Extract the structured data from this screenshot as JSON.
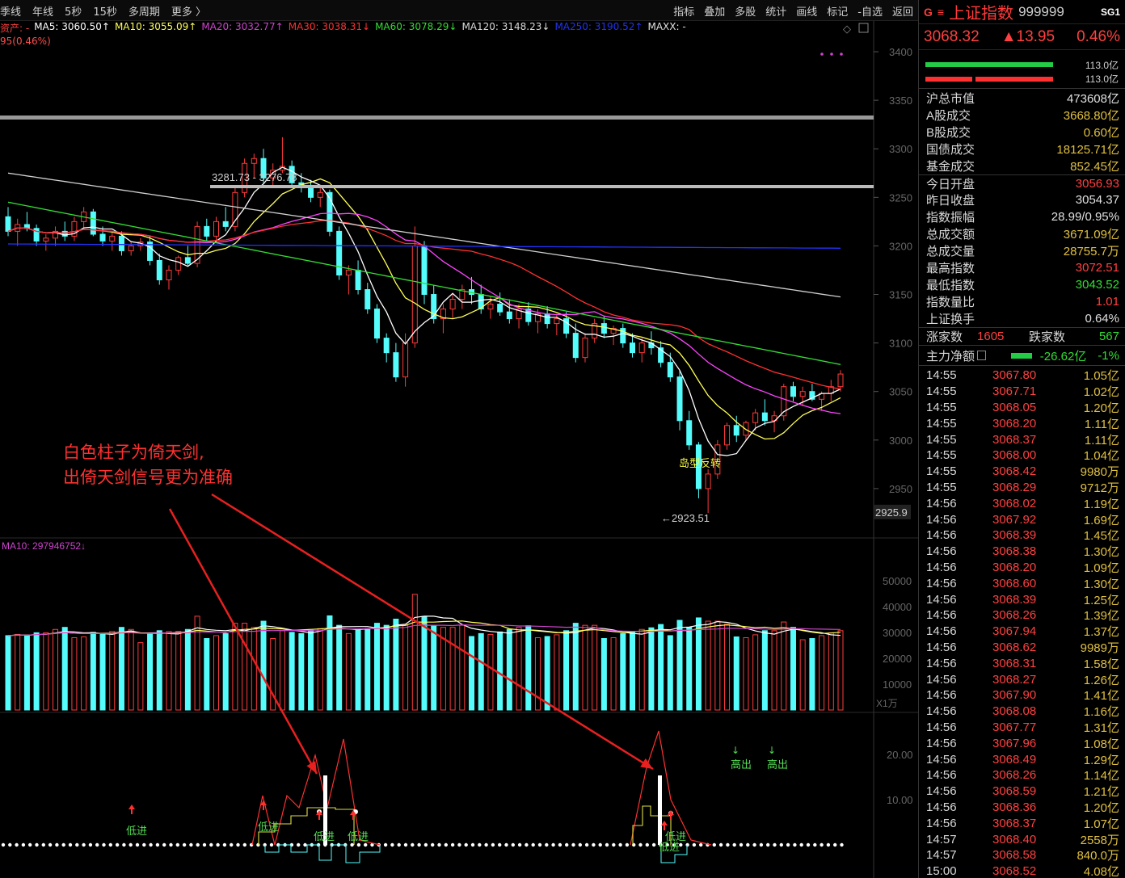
{
  "toolbar": {
    "left": [
      "季线",
      "年线",
      "5秒",
      "15秒",
      "多周期",
      "更多 〉"
    ],
    "right": [
      "指标",
      "叠加",
      "多股",
      "统计",
      "画线",
      "标记",
      "-自选",
      "返回"
    ]
  },
  "ma_line": {
    "prefix": "资产: -",
    "ma5": "MA5: 3060.50↑",
    "ma10": "MA10: 3055.09↑",
    "ma20": "MA20: 3032.77↑",
    "ma30": "MA30: 3038.31↓",
    "ma60": "MA60: 3078.29↓",
    "ma120": "MA120: 3148.23↓",
    "ma250": "MA250: 3190.52↑",
    "maxx": "MAXX: -",
    "change": "95(0.46%)"
  },
  "colors": {
    "up": "#ff3b3b",
    "down": "#54fcfc",
    "ma5": "#ffffff",
    "ma10": "#ffff55",
    "ma20": "#ff44ff",
    "ma30": "#ff3030",
    "ma60": "#33dd33",
    "ma120": "#cfcfcf",
    "ma250": "#2233ff"
  },
  "price_axis": [
    "3400",
    "3350",
    "3300",
    "3250",
    "3200",
    "3150",
    "3100",
    "3050",
    "3000",
    "2950"
  ],
  "price_current_tag": "2925.9",
  "high_label": "3281.73 - 3276.78",
  "low_label": "←2923.51",
  "pattern_label": "岛型反转",
  "annotation": {
    "line1": "白色柱子为倚天剑,",
    "line2": "出倚天剑信号更为准确"
  },
  "volume": {
    "ma_label": "MA10: 297946752↓",
    "axis": [
      "50000",
      "40000",
      "30000",
      "20000",
      "10000"
    ],
    "unit": "X1万"
  },
  "indicator": {
    "axis": [
      "20.00",
      "10.00"
    ],
    "labels": {
      "low_in_1": "低进",
      "low_in_2": "低进",
      "low_in_3": "低进",
      "low_in_4": "低进",
      "low_in_5": "低进",
      "low_in_6": "低进",
      "high_out_1": "高出",
      "high_out_2": "高出"
    }
  },
  "panel": {
    "g": "G",
    "menu": "≡",
    "name": "上证指数",
    "code": "999999",
    "sg": "SG1",
    "price": "3068.32",
    "change": "▲13.95",
    "pct": "0.46%",
    "bar_top": "113.0亿",
    "bar_bottom": "113.0亿",
    "stats": [
      {
        "label": "沪总市值",
        "value": "473608亿",
        "color": "#e0e0e0"
      },
      {
        "label": "A股成交",
        "value": "3668.80亿",
        "color": "#e0c040"
      },
      {
        "label": "B股成交",
        "value": "0.60亿",
        "color": "#e0c040"
      },
      {
        "label": "国债成交",
        "value": "18125.71亿",
        "color": "#e0c040"
      },
      {
        "label": "基金成交",
        "value": "852.45亿",
        "color": "#e0c040"
      },
      {
        "label": "今日开盘",
        "value": "3056.93",
        "color": "#ff4040"
      },
      {
        "label": "昨日收盘",
        "value": "3054.37",
        "color": "#e0e0e0"
      },
      {
        "label": "指数振幅",
        "value": "28.99/0.95%",
        "color": "#e0e0e0"
      },
      {
        "label": "总成交额",
        "value": "3671.09亿",
        "color": "#e0c040"
      },
      {
        "label": "总成交量",
        "value": "28755.7万",
        "color": "#e0c040"
      },
      {
        "label": "最高指数",
        "value": "3072.51",
        "color": "#ff4040"
      },
      {
        "label": "最低指数",
        "value": "3043.52",
        "color": "#33dd33"
      },
      {
        "label": "指数量比",
        "value": "1.01",
        "color": "#ff4040"
      },
      {
        "label": "上证换手",
        "value": "0.64%",
        "color": "#e0e0e0"
      }
    ],
    "rise_label": "涨家数",
    "rise_value": "1605",
    "fall_label": "跌家数",
    "fall_value": "567",
    "flow_label": "主力净额",
    "flow_value": "-26.62亿",
    "flow_pct": "-1%",
    "ticks": [
      [
        "14:55",
        "3067.80",
        "1.05亿"
      ],
      [
        "14:55",
        "3067.71",
        "1.02亿"
      ],
      [
        "14:55",
        "3068.05",
        "1.20亿"
      ],
      [
        "14:55",
        "3068.20",
        "1.11亿"
      ],
      [
        "14:55",
        "3068.37",
        "1.11亿"
      ],
      [
        "14:55",
        "3068.00",
        "1.04亿"
      ],
      [
        "14:55",
        "3068.42",
        "9980万"
      ],
      [
        "14:55",
        "3068.29",
        "9712万"
      ],
      [
        "14:56",
        "3068.02",
        "1.19亿"
      ],
      [
        "14:56",
        "3067.92",
        "1.69亿"
      ],
      [
        "14:56",
        "3068.39",
        "1.45亿"
      ],
      [
        "14:56",
        "3068.38",
        "1.30亿"
      ],
      [
        "14:56",
        "3068.20",
        "1.09亿"
      ],
      [
        "14:56",
        "3068.60",
        "1.30亿"
      ],
      [
        "14:56",
        "3068.39",
        "1.25亿"
      ],
      [
        "14:56",
        "3068.26",
        "1.39亿"
      ],
      [
        "14:56",
        "3067.94",
        "1.37亿"
      ],
      [
        "14:56",
        "3068.62",
        "9989万"
      ],
      [
        "14:56",
        "3068.31",
        "1.58亿"
      ],
      [
        "14:56",
        "3068.27",
        "1.26亿"
      ],
      [
        "14:56",
        "3067.90",
        "1.41亿"
      ],
      [
        "14:56",
        "3068.08",
        "1.16亿"
      ],
      [
        "14:56",
        "3067.77",
        "1.31亿"
      ],
      [
        "14:56",
        "3067.96",
        "1.08亿"
      ],
      [
        "14:56",
        "3068.49",
        "1.29亿"
      ],
      [
        "14:56",
        "3068.26",
        "1.14亿"
      ],
      [
        "14:56",
        "3068.59",
        "1.21亿"
      ],
      [
        "14:56",
        "3068.36",
        "1.20亿"
      ],
      [
        "14:56",
        "3068.37",
        "1.07亿"
      ],
      [
        "14:57",
        "3068.40",
        "2558万"
      ],
      [
        "14:57",
        "3068.58",
        "840.0万"
      ],
      [
        "15:00",
        "3068.52",
        "4.08亿"
      ]
    ]
  },
  "chart_data": {
    "type": "candlestick",
    "title": "",
    "ylim": [
      2900,
      3420
    ],
    "candles": [
      [
        3230,
        3240,
        3210,
        3215
      ],
      [
        3215,
        3228,
        3200,
        3222
      ],
      [
        3222,
        3235,
        3215,
        3218
      ],
      [
        3218,
        3222,
        3200,
        3205
      ],
      [
        3205,
        3212,
        3195,
        3208
      ],
      [
        3208,
        3220,
        3200,
        3215
      ],
      [
        3215,
        3225,
        3205,
        3210
      ],
      [
        3210,
        3230,
        3205,
        3225
      ],
      [
        3225,
        3240,
        3218,
        3235
      ],
      [
        3235,
        3238,
        3210,
        3212
      ],
      [
        3212,
        3220,
        3200,
        3205
      ],
      [
        3205,
        3215,
        3195,
        3210
      ],
      [
        3210,
        3215,
        3190,
        3195
      ],
      [
        3195,
        3205,
        3190,
        3200
      ],
      [
        3200,
        3208,
        3195,
        3204
      ],
      [
        3204,
        3210,
        3180,
        3185
      ],
      [
        3185,
        3192,
        3160,
        3165
      ],
      [
        3165,
        3180,
        3155,
        3175
      ],
      [
        3175,
        3190,
        3170,
        3188
      ],
      [
        3188,
        3200,
        3180,
        3182
      ],
      [
        3182,
        3225,
        3178,
        3220
      ],
      [
        3220,
        3228,
        3205,
        3210
      ],
      [
        3210,
        3230,
        3205,
        3225
      ],
      [
        3225,
        3240,
        3215,
        3220
      ],
      [
        3220,
        3260,
        3215,
        3255
      ],
      [
        3255,
        3290,
        3250,
        3285
      ],
      [
        3285,
        3295,
        3270,
        3290
      ],
      [
        3290,
        3300,
        3265,
        3270
      ],
      [
        3270,
        3285,
        3262,
        3278
      ],
      [
        3278,
        3312,
        3275,
        3282
      ],
      [
        3282,
        3288,
        3260,
        3265
      ],
      [
        3265,
        3275,
        3255,
        3260
      ],
      [
        3260,
        3268,
        3245,
        3250
      ],
      [
        3250,
        3262,
        3240,
        3255
      ],
      [
        3255,
        3258,
        3210,
        3215
      ],
      [
        3215,
        3220,
        3165,
        3170
      ],
      [
        3170,
        3180,
        3150,
        3175
      ],
      [
        3175,
        3185,
        3150,
        3155
      ],
      [
        3155,
        3162,
        3130,
        3135
      ],
      [
        3135,
        3140,
        3100,
        3105
      ],
      [
        3105,
        3110,
        3080,
        3090
      ],
      [
        3090,
        3100,
        3060,
        3065
      ],
      [
        3065,
        3110,
        3055,
        3100
      ],
      [
        3100,
        3220,
        3095,
        3200
      ],
      [
        3200,
        3205,
        3140,
        3150
      ],
      [
        3150,
        3160,
        3120,
        3125
      ],
      [
        3125,
        3140,
        3110,
        3135
      ],
      [
        3135,
        3150,
        3125,
        3145
      ],
      [
        3145,
        3160,
        3135,
        3155
      ],
      [
        3155,
        3168,
        3140,
        3150
      ],
      [
        3150,
        3160,
        3130,
        3135
      ],
      [
        3135,
        3148,
        3125,
        3140
      ],
      [
        3140,
        3152,
        3128,
        3132
      ],
      [
        3132,
        3145,
        3120,
        3125
      ],
      [
        3125,
        3140,
        3115,
        3135
      ],
      [
        3135,
        3142,
        3118,
        3122
      ],
      [
        3122,
        3135,
        3110,
        3130
      ],
      [
        3130,
        3138,
        3115,
        3120
      ],
      [
        3120,
        3130,
        3108,
        3125
      ],
      [
        3125,
        3132,
        3105,
        3110
      ],
      [
        3110,
        3120,
        3080,
        3085
      ],
      [
        3085,
        3110,
        3080,
        3105
      ],
      [
        3105,
        3125,
        3100,
        3120
      ],
      [
        3120,
        3128,
        3105,
        3110
      ],
      [
        3110,
        3118,
        3098,
        3115
      ],
      [
        3115,
        3120,
        3095,
        3100
      ],
      [
        3100,
        3110,
        3085,
        3090
      ],
      [
        3090,
        3105,
        3080,
        3100
      ],
      [
        3100,
        3112,
        3088,
        3095
      ],
      [
        3095,
        3102,
        3075,
        3080
      ],
      [
        3080,
        3090,
        3060,
        3065
      ],
      [
        3065,
        3072,
        3010,
        3020
      ],
      [
        3020,
        3030,
        2990,
        2995
      ],
      [
        2995,
        2998,
        2940,
        2950
      ],
      [
        2950,
        2970,
        2925,
        2965
      ],
      [
        2965,
        3000,
        2960,
        2995
      ],
      [
        2995,
        3018,
        2990,
        3015
      ],
      [
        3015,
        3025,
        2998,
        3005
      ],
      [
        3005,
        3020,
        3000,
        3018
      ],
      [
        3018,
        3032,
        3010,
        3028
      ],
      [
        3028,
        3042,
        3015,
        3020
      ],
      [
        3020,
        3030,
        3008,
        3025
      ],
      [
        3025,
        3058,
        3020,
        3055
      ],
      [
        3055,
        3060,
        3040,
        3045
      ],
      [
        3045,
        3055,
        3035,
        3050
      ],
      [
        3050,
        3058,
        3040,
        3042
      ],
      [
        3042,
        3050,
        3030,
        3048
      ],
      [
        3048,
        3062,
        3040,
        3055
      ],
      [
        3055,
        3072,
        3050,
        3068
      ]
    ]
  }
}
